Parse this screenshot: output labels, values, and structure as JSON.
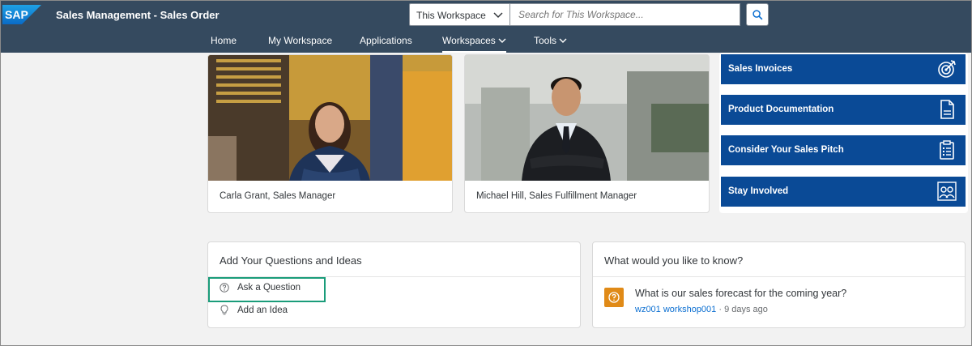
{
  "header": {
    "logo": "SAP",
    "title": "Sales Management - Sales Order",
    "scope_select": "This Workspace",
    "search_placeholder": "Search for This Workspace..."
  },
  "nav": {
    "items": [
      {
        "label": "Home"
      },
      {
        "label": "My Workspace"
      },
      {
        "label": "Applications"
      },
      {
        "label": "Workspaces",
        "active": true,
        "has_dropdown": true
      },
      {
        "label": "Tools",
        "has_dropdown": true
      }
    ]
  },
  "people": [
    {
      "caption": "Carla Grant, Sales Manager"
    },
    {
      "caption": "Michael Hill, Sales Fulfillment Manager"
    }
  ],
  "tiles": [
    {
      "label": "Sales Invoices",
      "icon": "target-icon"
    },
    {
      "label": "Product Documentation",
      "icon": "document-icon"
    },
    {
      "label": "Consider Your Sales Pitch",
      "icon": "clipboard-icon"
    },
    {
      "label": "Stay Involved",
      "icon": "people-icon"
    }
  ],
  "ideas_card": {
    "title": "Add Your Questions and Ideas",
    "actions": [
      {
        "label": "Ask a Question",
        "icon": "question-icon"
      },
      {
        "label": "Add an Idea",
        "icon": "lightbulb-icon"
      }
    ]
  },
  "know_card": {
    "title": "What would you like to know?",
    "question": "What is our sales forecast for the coming year?",
    "author": "wz001 workshop001",
    "age": "· 9 days ago"
  },
  "colors": {
    "shell": "#354a5f",
    "tile": "#0a4a96",
    "highlight": "#1a9c7a",
    "question_badge": "#e08a17"
  }
}
